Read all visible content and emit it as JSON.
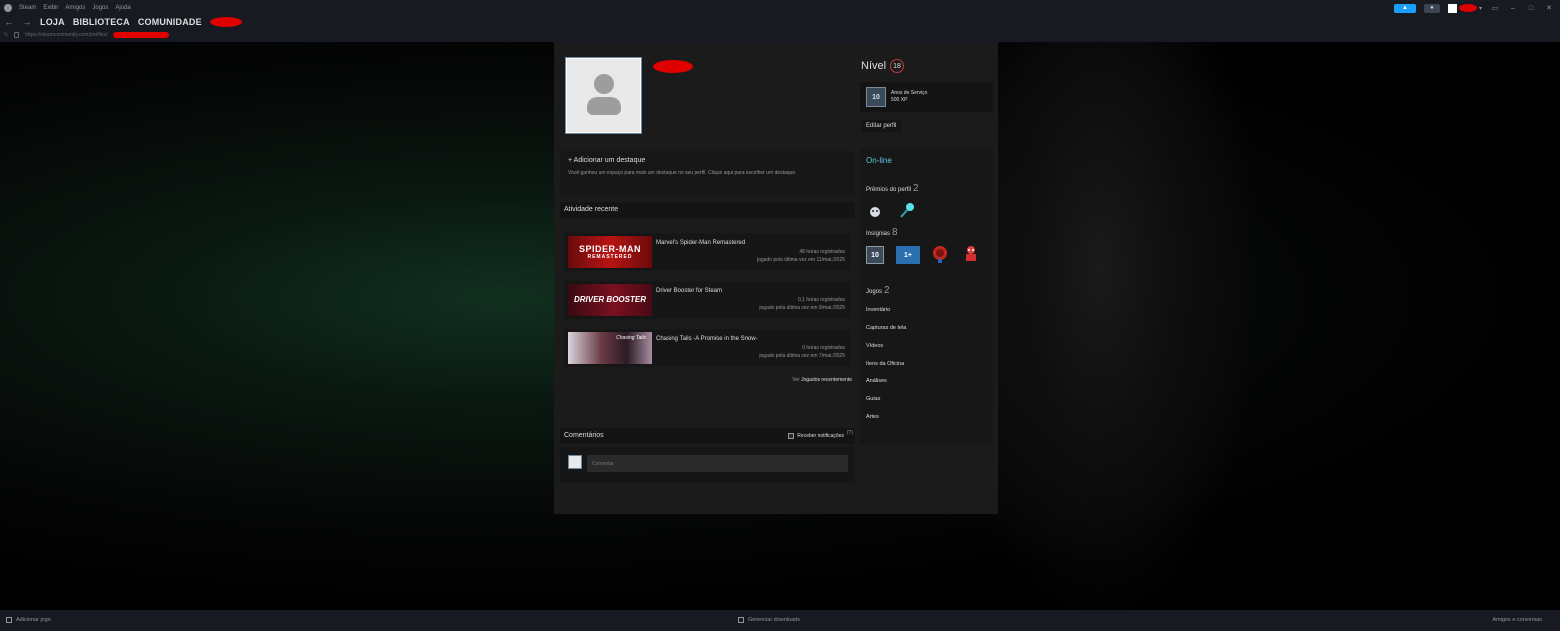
{
  "titlebar": {
    "menu": [
      "Steam",
      "Exibir",
      "Amigos",
      "Jogos",
      "Ajuda"
    ],
    "nav": [
      "LOJA",
      "BIBLIOTECA",
      "COMUNIDADE"
    ],
    "url": "https://steamcommunity.com/profiles/",
    "back_icon": "back-arrow-icon",
    "forward_icon": "forward-arrow-icon"
  },
  "profile": {
    "level_label": "Nível",
    "level": "18",
    "service": {
      "badge": "10",
      "title": "Anos de Serviço",
      "xp": "500 XP"
    },
    "edit_label": "Editar perfil",
    "showcase": {
      "title": "+ Adicionar um destaque",
      "description": "Você ganhou um espaço para mais um destaque no seu perfil. Clique aqui para escolher um destaque."
    },
    "activity_title": "Atividade recente",
    "games": [
      {
        "name": "Marvel's Spider-Man Remastered",
        "hours": "48 horas registradas",
        "last": "jogado pela última vez em 11/mai./2025",
        "cap_l1": "SPIDER-MAN",
        "cap_l2": "REMASTERED"
      },
      {
        "name": "Driver Booster for Steam",
        "hours": "0,1 horas registradas",
        "last": "jogado pela última vez em 9/mai./2025",
        "cap_l1": "DRIVER BOOSTER",
        "cap_l2": ""
      },
      {
        "name": "Chasing Tails -A Promise in the Snow-",
        "hours": "0 horas registradas",
        "last": "jogado pela última vez em 7/mai./2025",
        "cap_l1": "Chasing Tails",
        "cap_l2": ""
      }
    ],
    "see_more_prefix": "Ver",
    "see_more_link": "Jogados recentemente",
    "comments_title": "Comentários",
    "notif_label": "Receber notificações",
    "notif_count": "(?)",
    "comment_placeholder": "Comentar"
  },
  "sidebar": {
    "status": "On-line",
    "awards_label": "Prêmios do perfil",
    "awards_count": "2",
    "badges_label": "Insígnias",
    "badges_count": "8",
    "badge_10": "10",
    "badge_1plus": "1+",
    "games_label": "Jogos",
    "games_count": "2",
    "links": [
      "Inventário",
      "Capturas de tela",
      "Vídeos",
      "Itens da Oficina",
      "Análises",
      "Guias",
      "Artes"
    ]
  },
  "bottombar": {
    "add_game": "Adicionar jogo",
    "downloads": "Gerenciar downloads",
    "friends": "Amigos e conversas"
  },
  "colors": {
    "accent": "#1a9fff",
    "online": "#57cbde",
    "level_ring": "#c23a3a"
  }
}
